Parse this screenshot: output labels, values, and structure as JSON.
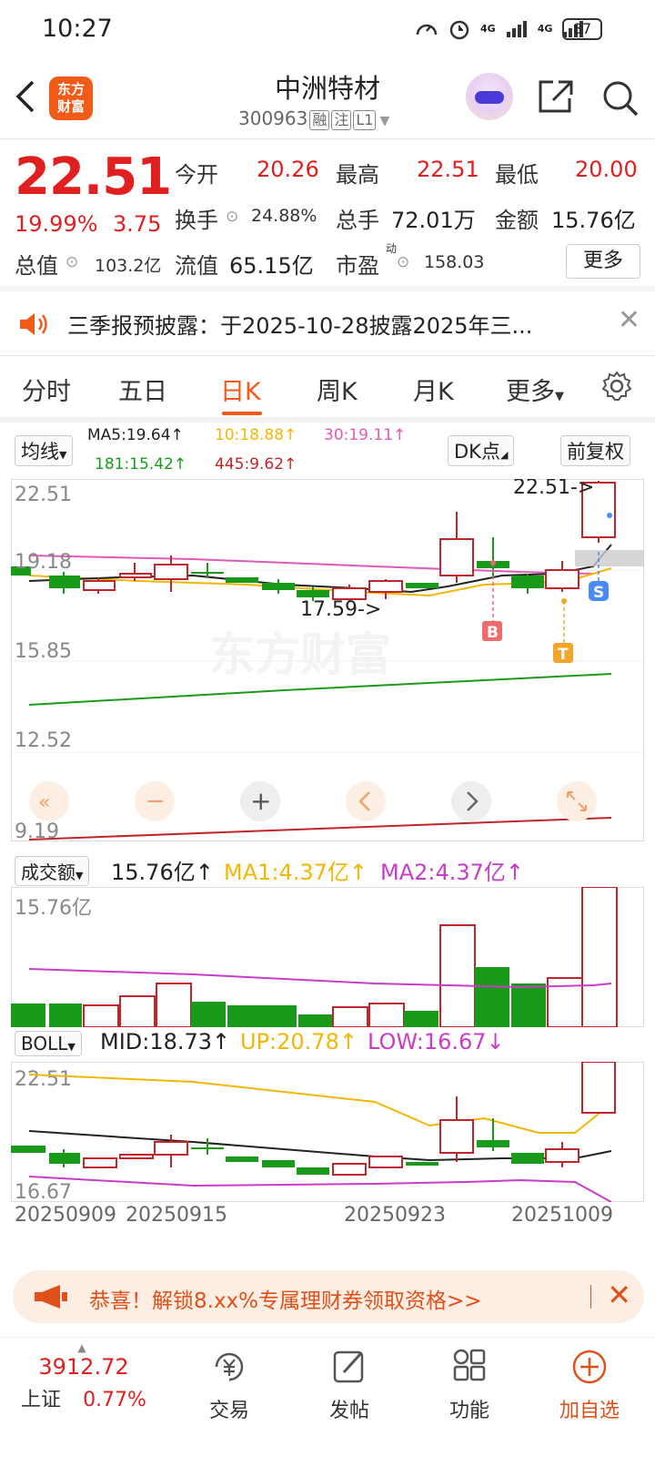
{
  "status_bar": {
    "time": "10:27",
    "network": "4G",
    "battery": "87"
  },
  "header": {
    "stock_name": "中洲特材",
    "stock_code": "300963",
    "tags": [
      "融",
      "注",
      "L1"
    ],
    "logo_text": "东方财富"
  },
  "quote": {
    "price": "22.51",
    "change_pct": "19.99%",
    "change": "3.75",
    "open_label": "今开",
    "open": "20.26",
    "high_label": "最高",
    "high": "22.51",
    "low_label": "最低",
    "low": "20.00",
    "turnover_label": "换手",
    "turnover": "24.88%",
    "volume_label": "总手",
    "volume": "72.01万",
    "amount_label": "金额",
    "amount": "15.76亿",
    "mktcap_label": "总值",
    "mktcap": "103.2亿",
    "float_label": "流值",
    "float": "65.15亿",
    "pe_label": "市盈",
    "pe_sup": "动",
    "pe": "158.03",
    "more": "更多"
  },
  "notice": {
    "text": "三季报预披露：于2025-10-28披露2025年三..."
  },
  "tabs": [
    "分时",
    "五日",
    "日K",
    "周K",
    "月K",
    "更多"
  ],
  "active_tab": "日K",
  "indicators": {
    "ma_select": "均线",
    "ma5": "MA5:19.64↑",
    "ma10": "10:18.88↑",
    "ma30": "30:19.11↑",
    "ma181": "181:15.42↑",
    "ma445": "445:9.62↑",
    "dk": "DK点",
    "adjust": "前复权"
  },
  "kline": {
    "y_labels": [
      "22.51",
      "19.18",
      "15.85",
      "12.52",
      "9.19"
    ],
    "price_high_note": "22.51->",
    "price_low_note": "17.59->",
    "markers": [
      "B",
      "T",
      "S"
    ],
    "watermark": "东方财富"
  },
  "volume": {
    "select": "成交额",
    "value": "15.76亿↑",
    "ma1": "MA1:4.37亿↑",
    "ma2": "MA2:4.37亿↑",
    "y_label": "15.76亿"
  },
  "boll": {
    "select": "BOLL",
    "mid": "MID:18.73↑",
    "up": "UP:20.78↑",
    "low": "LOW:16.67↓",
    "y_top": "22.51",
    "y_bottom": "16.67"
  },
  "dates": [
    "20250909",
    "20250915",
    "20250923",
    "20251009"
  ],
  "promo": {
    "text": "恭喜！解锁8.xx%专属理财券领取资格>>"
  },
  "bottom_nav": {
    "index_price": "3912.72",
    "index_name": "上证",
    "index_change": "0.77%",
    "items": [
      "交易",
      "发帖",
      "功能",
      "加自选"
    ]
  },
  "colors": {
    "up": "#e02020",
    "down": "#1a9a1a",
    "accent": "#f25a18",
    "ma5": "#222222",
    "ma10": "#f2b705",
    "ma30": "#e05ab8",
    "ma181": "#1a9a1a",
    "ma445": "#c0252a"
  }
}
